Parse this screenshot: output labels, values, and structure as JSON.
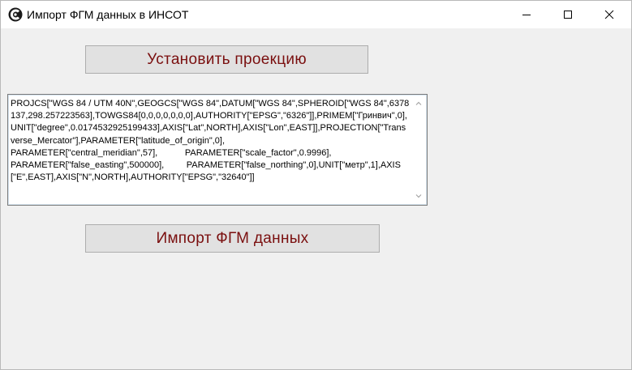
{
  "window": {
    "title": "Импорт ФГМ данных в ИНСОТ",
    "app_icon": "insot-logo-icon",
    "controls": [
      "minimize-icon",
      "maximize-icon",
      "close-icon"
    ]
  },
  "buttons": {
    "set_projection": "Установить проекцию",
    "import_data": "Импорт ФГМ данных"
  },
  "projection": {
    "text": "PROJCS[\"WGS 84 / UTM 40N\",GEOGCS[\"WGS 84\",DATUM[\"WGS 84\",SPHEROID[\"WGS 84\",6378137,298.257223563],TOWGS84[0,0,0,0,0,0,0],AUTHORITY[\"EPSG\",\"6326\"]],PRIMEM[\"Гринвич\",0],UNIT[\"degree\",0.0174532925199433],AXIS[\"Lat\",NORTH],AXIS[\"Lon\",EAST]],PROJECTION[\"Transverse_Mercator\"],PARAMETER[\"latitude_of_origin\",0],\nPARAMETER[\"central_meridian\",57],           PARAMETER[\"scale_factor\",0.9996],\nPARAMETER[\"false_easting\",500000],         PARAMETER[\"false_northing\",0],UNIT[\"метр\",1],AXIS[\"E\",EAST],AXIS[\"N\",NORTH],AUTHORITY[\"EPSG\",\"32640\"]]"
  },
  "colors": {
    "button_text": "#7a0f0f",
    "window_bg": "#f0f0f0"
  }
}
